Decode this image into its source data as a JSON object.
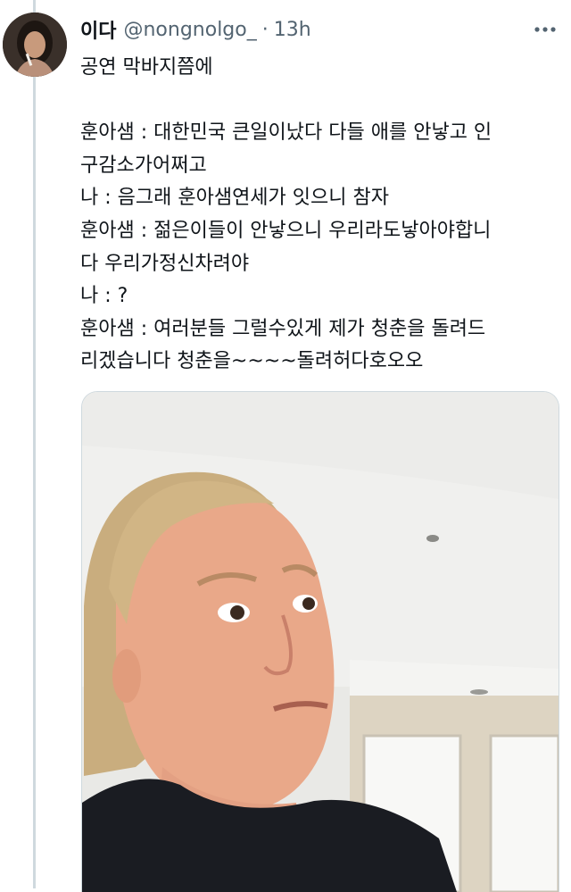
{
  "tweet": {
    "display_name": "이다",
    "handle": "@nongnolgo_",
    "separator": "·",
    "time": "13h",
    "lines": [
      "공연 막바지쯤에",
      "",
      "훈아샘 : 대한민국 큰일이났다 다들 애를 안낳고 인",
      "구감소가어쩌고",
      "나 : 음그래 훈아샘연세가 잇으니 참자",
      "훈아샘 : 젊은이들이 안낳으니 우리라도낳아야합니",
      "다 우리가정신차려야",
      "나 : ?",
      "훈아샘 : 여러분들 그럴수있게 제가 청춘을 돌려드",
      "리겠습니다 청춘을~~~~돌려허다호오오"
    ]
  },
  "icons": {
    "more": "more-horizontal-icon",
    "avatar": "user-avatar"
  },
  "colors": {
    "text": "#0f1419",
    "secondary": "#536471",
    "border": "#cfd9de"
  }
}
